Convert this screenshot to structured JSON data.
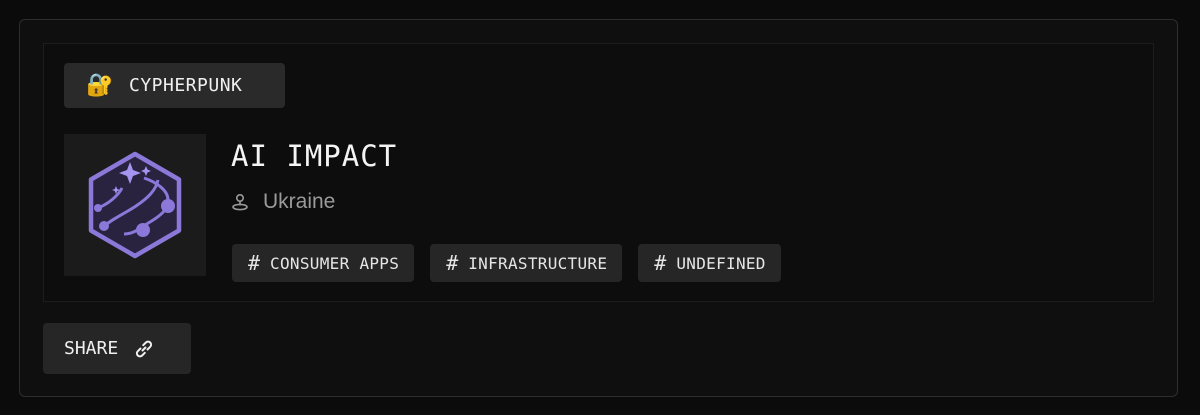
{
  "track": {
    "emoji": "🔐",
    "label": "CYPHERPUNK"
  },
  "project": {
    "logo_icon": "hexagon-path-sparkle-logo",
    "title": "AI IMPACT",
    "location_icon": "map-pin-icon",
    "location": "Ukraine"
  },
  "tags": [
    {
      "hash": "#",
      "label": "CONSUMER APPS"
    },
    {
      "hash": "#",
      "label": "INFRASTRUCTURE"
    },
    {
      "hash": "#",
      "label": "UNDEFINED"
    }
  ],
  "share": {
    "label": "SHARE",
    "icon": "link-icon"
  },
  "colors": {
    "accent": "#8b78d8",
    "background": "#0b0b0b",
    "chip": "#262626"
  }
}
